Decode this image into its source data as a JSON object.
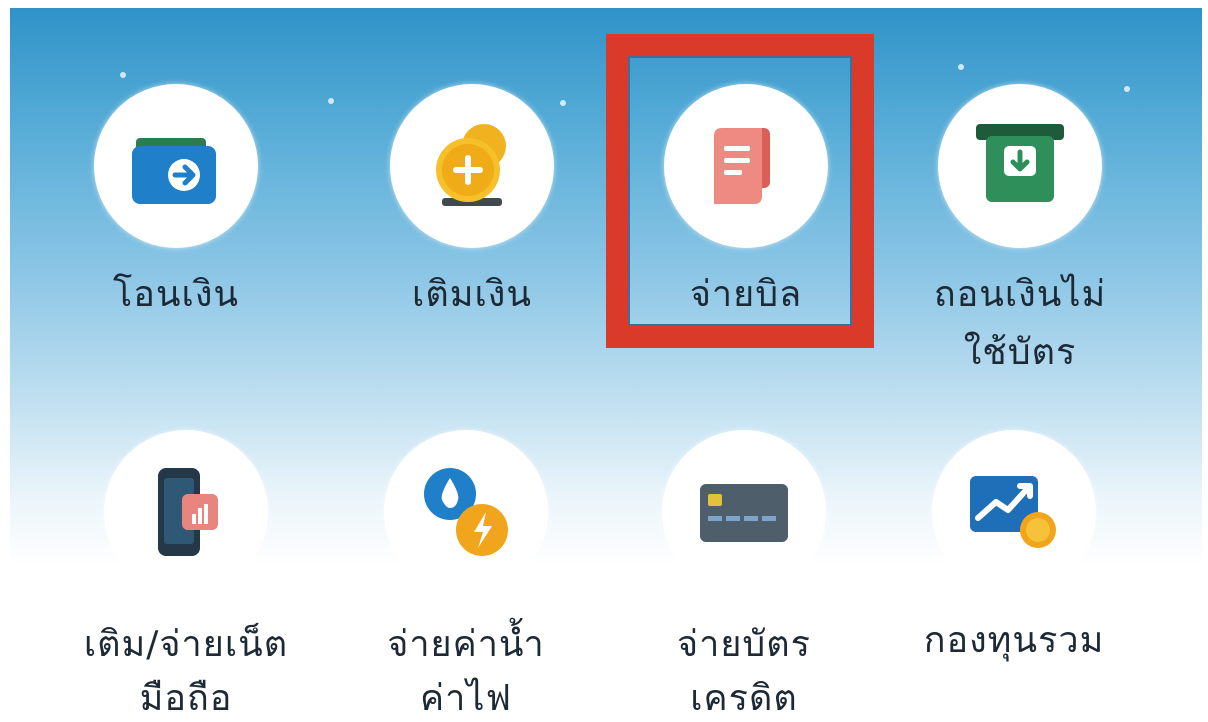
{
  "menu": {
    "row1": [
      {
        "label": "โอนเงิน",
        "icon": "wallet-transfer-icon"
      },
      {
        "label": "เติมเงิน",
        "icon": "coin-topup-icon"
      },
      {
        "label": "จ่ายบิล",
        "icon": "bill-icon"
      },
      {
        "label_line1": "ถอนเงินไม่",
        "label_line2": "ใช้บัตร",
        "icon": "atm-withdraw-icon"
      }
    ],
    "row2": [
      {
        "label_line1": "เติม/จ่ายเน็ต",
        "label_line2": "มือถือ",
        "icon": "mobile-topup-icon"
      },
      {
        "label_line1": "จ่ายค่าน้ำ",
        "label_line2": "ค่าไฟ",
        "icon": "water-electric-icon"
      },
      {
        "label_line1": "จ่ายบัตร",
        "label_line2": "เครดิต",
        "icon": "credit-card-icon"
      },
      {
        "label": "กองทุนรวม",
        "icon": "mutual-fund-icon"
      }
    ]
  },
  "colors": {
    "highlight_border": "#d93a2a",
    "sky_top": "#2f93c8",
    "label_text": "#1d2a36"
  }
}
